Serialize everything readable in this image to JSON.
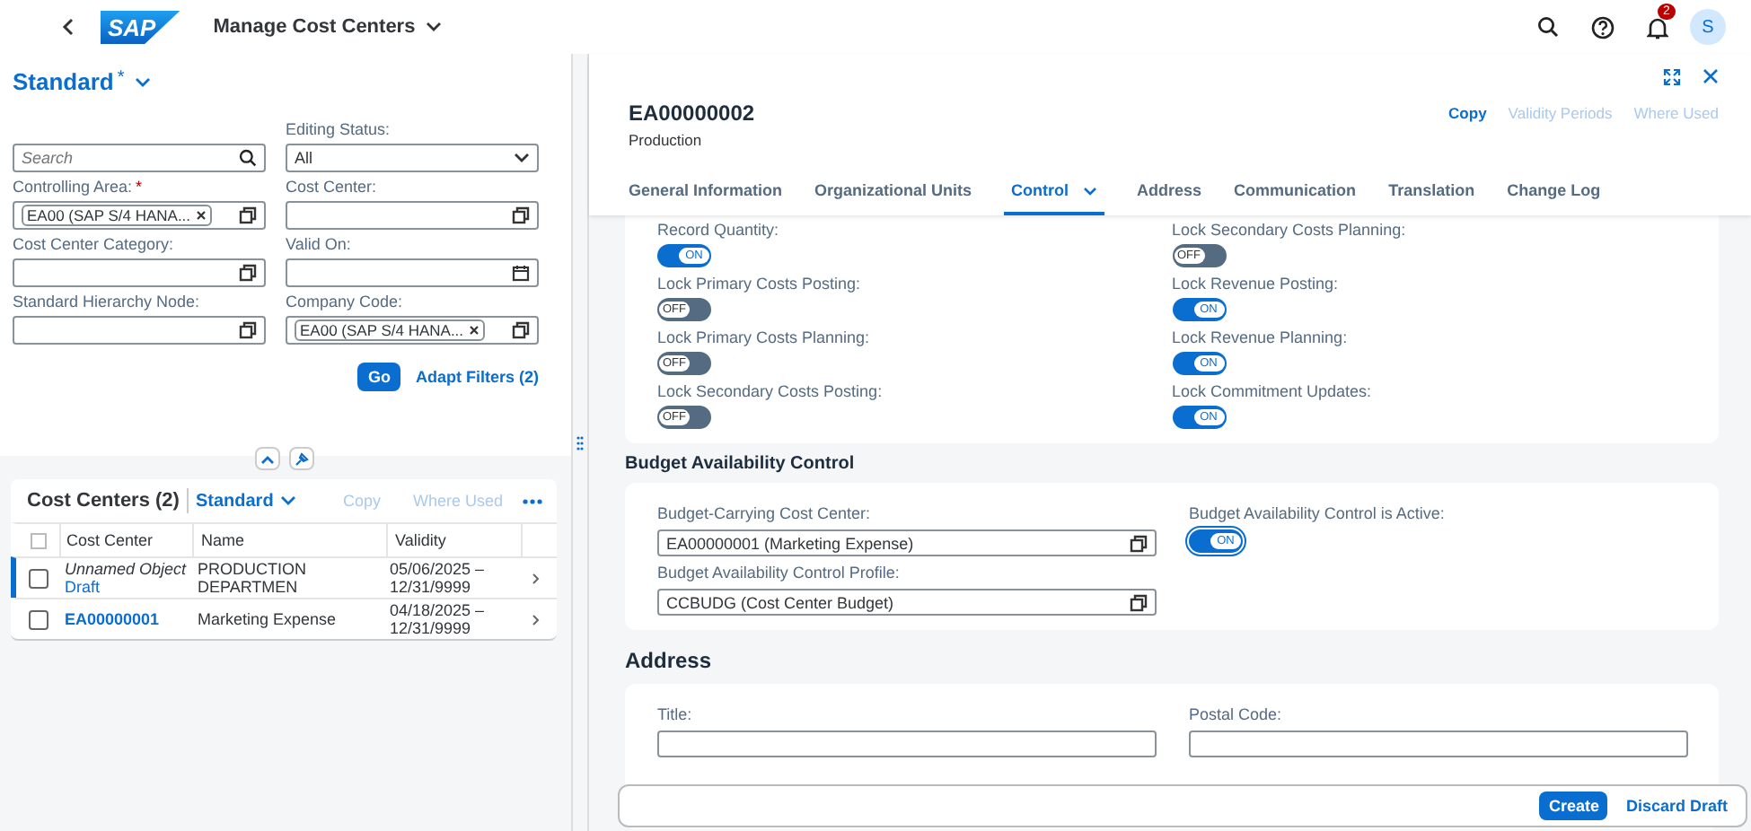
{
  "shell": {
    "logo": "SAP",
    "title": "Manage Cost Centers",
    "notification_count": "2",
    "avatar_initial": "S"
  },
  "variant": {
    "label": "Standard",
    "modified_mark": "*"
  },
  "filter_search": {
    "placeholder": "Search"
  },
  "filters": [
    {
      "kind": "select",
      "label": "Editing Status:",
      "required": false,
      "value": "All"
    },
    {
      "kind": "token",
      "label": "Controlling Area:",
      "required": true,
      "token": "EA00 (SAP S/4 HANA..."
    },
    {
      "kind": "input",
      "label": "Cost Center:",
      "required": false
    },
    {
      "kind": "input",
      "label": "Cost Center Category:",
      "required": false
    },
    {
      "kind": "date",
      "label": "Valid On:",
      "required": false
    },
    {
      "kind": "input",
      "label": "Standard Hierarchy Node:",
      "required": false
    },
    {
      "kind": "token",
      "label": "Company Code:",
      "required": false,
      "token": "EA00 (SAP S/4 HANA..."
    }
  ],
  "filter_buttons": {
    "go": "Go",
    "adapt": "Adapt Filters (2)"
  },
  "table": {
    "title": "Cost Centers (2)",
    "variant": "Standard",
    "actions": [
      {
        "label": "Copy",
        "disabled": true
      },
      {
        "label": "Where Used",
        "disabled": true
      }
    ],
    "select_all_checked": false,
    "columns": [
      "Cost Center",
      "Name",
      "Validity"
    ],
    "rows": [
      {
        "checked": false,
        "navigated": true,
        "cost_center": "Unnamed Object",
        "draft": "Draft",
        "italic": true,
        "name": "PRODUCTION DEPARTMEN",
        "validity": [
          "05/06/2025 –",
          "12/31/9999"
        ]
      },
      {
        "checked": false,
        "navigated": false,
        "cost_center": "EA00000001",
        "draft": "",
        "italic": false,
        "name": "Marketing Expense",
        "validity": [
          "04/18/2025 –",
          "12/31/9999"
        ]
      }
    ]
  },
  "detail": {
    "title": "EA00000002",
    "subtitle": "Production",
    "actions": [
      {
        "label": "Copy",
        "disabled": false
      },
      {
        "label": "Validity Periods",
        "disabled": true
      },
      {
        "label": "Where Used",
        "disabled": true
      }
    ],
    "tabs": [
      {
        "label": "General Information",
        "selected": false,
        "menu": false
      },
      {
        "label": "Organizational Units",
        "selected": false,
        "menu": false
      },
      {
        "label": "Control",
        "selected": true,
        "menu": true
      },
      {
        "label": "Address",
        "selected": false,
        "menu": false
      },
      {
        "label": "Communication",
        "selected": false,
        "menu": false
      },
      {
        "label": "Translation",
        "selected": false,
        "menu": false
      },
      {
        "label": "Change Log",
        "selected": false,
        "menu": false
      }
    ],
    "toggles": [
      {
        "label": "Record Quantity:",
        "on": true,
        "text": "ON"
      },
      {
        "label": "Lock Secondary Costs Planning:",
        "on": false,
        "text": "OFF"
      },
      {
        "label": "Lock Primary Costs Posting:",
        "on": false,
        "text": "OFF"
      },
      {
        "label": "Lock Revenue Posting:",
        "on": true,
        "text": "ON"
      },
      {
        "label": "Lock Primary Costs Planning:",
        "on": false,
        "text": "OFF"
      },
      {
        "label": "Lock Revenue Planning:",
        "on": true,
        "text": "ON"
      },
      {
        "label": "Lock Secondary Costs Posting:",
        "on": false,
        "text": "OFF"
      },
      {
        "label": "Lock Commitment Updates:",
        "on": true,
        "text": "ON"
      }
    ],
    "budget": {
      "title": "Budget Availability Control",
      "fields": [
        {
          "label": "Budget-Carrying Cost Center:",
          "value": "EA00000001 (Marketing Expense)"
        },
        {
          "label": "Budget Availability Control Profile:",
          "value": "CCBUDG (Cost Center Budget)"
        }
      ],
      "active": {
        "label": "Budget Availability Control is Active:",
        "on": true,
        "text": "ON"
      }
    },
    "address": {
      "title": "Address",
      "fields": [
        "Title:",
        "Postal Code:"
      ]
    },
    "footer": [
      {
        "label": "Create",
        "emphasized": true
      },
      {
        "label": "Discard Draft",
        "emphasized": false
      }
    ]
  }
}
